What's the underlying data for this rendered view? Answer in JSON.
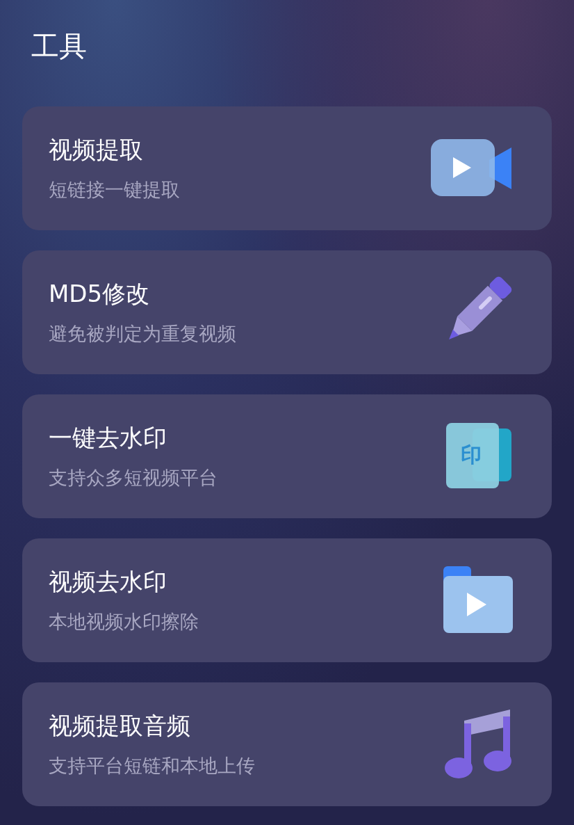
{
  "header": {
    "title": "工具"
  },
  "tools": [
    {
      "title": "视频提取",
      "subtitle": "短链接一键提取",
      "kind": "video"
    },
    {
      "title": "MD5修改",
      "subtitle": "避免被判定为重复视频",
      "kind": "pencil"
    },
    {
      "title": "一键去水印",
      "subtitle": "支持众多短视频平台",
      "kind": "stamp",
      "icon_glyph": "印"
    },
    {
      "title": "视频去水印",
      "subtitle": "本地视频水印擦除",
      "kind": "folder"
    },
    {
      "title": "视频提取音频",
      "subtitle": "支持平台短链和本地上传",
      "kind": "music"
    }
  ]
}
